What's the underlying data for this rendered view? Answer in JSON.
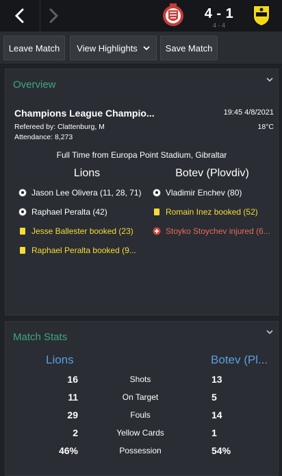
{
  "header": {
    "score": "4 - 1",
    "aggregate": "4 - 4"
  },
  "toolbar": {
    "leave_label": "Leave Match",
    "highlights_label": "View Highlights",
    "save_label": "Save Match"
  },
  "overview": {
    "title": "Overview",
    "competition": "Champions League Champio...",
    "datetime": "19:45 4/8/2021",
    "referee": "Refereed by: Clattenburg, M",
    "temperature": "18°C",
    "attendance": "Attendance: 8,273",
    "fulltime": "Full Time from Europa Point Stadium, Gibraltar",
    "home_team": "Lions",
    "away_team": "Botev (Plovdiv)",
    "home_events": [
      {
        "icon": "football-icon",
        "text": "Jason Lee Olivera (11, 28, 71)"
      },
      {
        "icon": "football-icon",
        "text": "Raphael Peralta (42)"
      },
      {
        "icon": "yellow-card-icon",
        "text": "Jesse Ballester booked (23)"
      },
      {
        "icon": "yellow-card-icon",
        "text": "Raphael Peralta booked (9..."
      }
    ],
    "away_events": [
      {
        "icon": "football-icon",
        "text": "Vladimir Enchev (80)"
      },
      {
        "icon": "yellow-card-icon",
        "text": "Romain Inez booked (52)"
      },
      {
        "icon": "injury-icon",
        "text": "Stoyko Stoychev injured (6..."
      }
    ]
  },
  "stats": {
    "title": "Match Stats",
    "home_team": "Lions",
    "away_team": "Botev (Pl...",
    "rows": [
      {
        "label": "Shots",
        "home": "16",
        "away": "13"
      },
      {
        "label": "On Target",
        "home": "11",
        "away": "5"
      },
      {
        "label": "Fouls",
        "home": "29",
        "away": "14"
      },
      {
        "label": "Yellow Cards",
        "home": "2",
        "away": "1"
      },
      {
        "label": "Possession",
        "home": "46%",
        "away": "54%"
      }
    ]
  },
  "colors": {
    "accent_green": "#3ea880",
    "stats_blue": "#5aa0e6",
    "yellow_event": "#f5dd34",
    "injury_red": "#e46b5a"
  }
}
